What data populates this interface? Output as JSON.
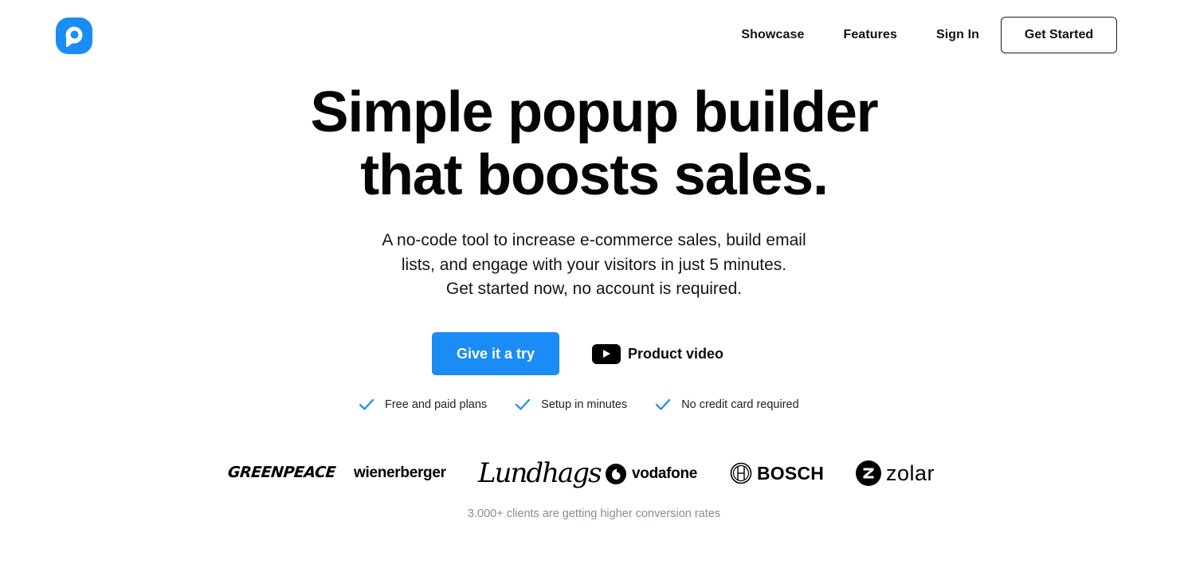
{
  "brand": {
    "accent_color": "#1a8cf5"
  },
  "nav": {
    "links": [
      {
        "label": "Showcase"
      },
      {
        "label": "Features"
      },
      {
        "label": "Sign In"
      }
    ],
    "cta_label": "Get Started"
  },
  "hero": {
    "title_line1": "Simple popup builder",
    "title_line2": "that boosts sales.",
    "subtitle_line1": "A no-code tool to increase e-commerce sales, build email",
    "subtitle_line2": "lists, and engage with your visitors in just 5 minutes.",
    "subtitle_line3": "Get started now, no account is required.",
    "primary_cta": "Give it a try",
    "video_cta": "Product video"
  },
  "features": [
    {
      "icon": "check-icon",
      "label": "Free and paid plans"
    },
    {
      "icon": "check-icon",
      "label": "Setup in minutes"
    },
    {
      "icon": "check-icon",
      "label": "No credit card required"
    }
  ],
  "client_logos": [
    {
      "name": "GREENPEACE"
    },
    {
      "name": "wienerberger"
    },
    {
      "name": "Lundhags"
    },
    {
      "name": "vodafone"
    },
    {
      "name": "BOSCH"
    },
    {
      "name": "zolar"
    }
  ],
  "clients_caption": "3.000+ clients are getting higher conversion rates"
}
